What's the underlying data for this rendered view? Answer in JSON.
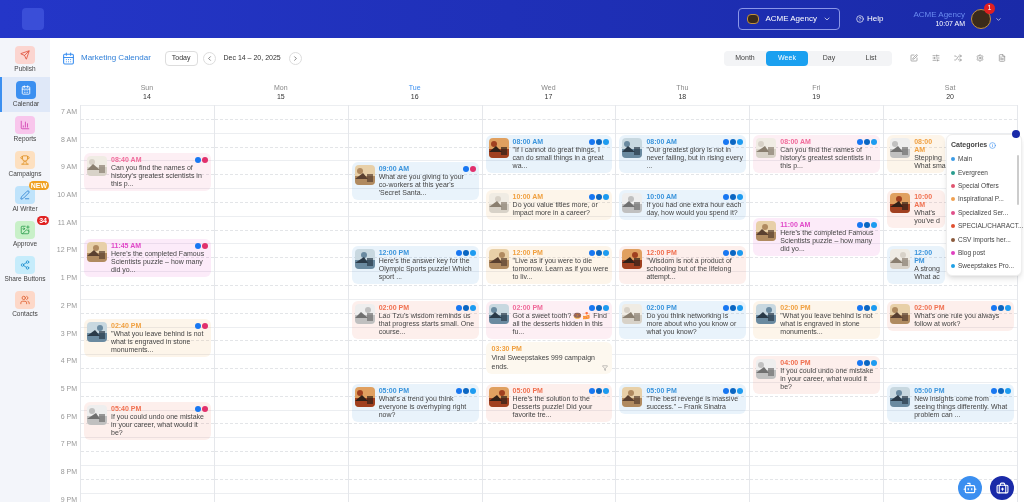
{
  "topbar": {
    "agency_button": "ACME Agency",
    "help": "Help",
    "account_name": "ACME Agency",
    "time": "10:07 AM",
    "notification_count": "1"
  },
  "sidebar": [
    {
      "kind": "publish",
      "label": "Publish",
      "selected": false
    },
    {
      "kind": "calendar",
      "label": "Calendar",
      "selected": true
    },
    {
      "kind": "reports",
      "label": "Reports",
      "selected": false
    },
    {
      "kind": "campaigns",
      "label": "Campaigns",
      "selected": false
    },
    {
      "kind": "writer",
      "label": "AI Writer",
      "selected": false,
      "badge": "NEW",
      "color": "#f0a020"
    },
    {
      "kind": "approve",
      "label": "Approve",
      "selected": false,
      "badge": "34",
      "color": "#e02020"
    },
    {
      "kind": "share",
      "label": "Share Buttons",
      "selected": false
    },
    {
      "kind": "contacts",
      "label": "Contacts",
      "selected": false
    }
  ],
  "toolbar": {
    "title": "Marketing Calendar",
    "today": "Today",
    "range": "Dec 14 – 20, 2025",
    "views": [
      {
        "label": "Month",
        "selected": false
      },
      {
        "label": "Week",
        "selected": true
      },
      {
        "label": "Day",
        "selected": false
      },
      {
        "label": "List",
        "selected": false
      }
    ]
  },
  "hours": [
    "7 AM",
    "8 AM",
    "9 AM",
    "10 AM",
    "11 AM",
    "12 PM",
    "1 PM",
    "2 PM",
    "3 PM",
    "4 PM",
    "5 PM",
    "6 PM",
    "7 PM",
    "8 PM",
    "9 PM"
  ],
  "days": [
    {
      "name": "Sun",
      "date": "14",
      "today": false,
      "events": [
        {
          "kind": "post",
          "time": "08:40 AM",
          "color": "#f06a9a",
          "text": "Can you find the names of history's greatest scientists in this p...",
          "networks": [
            {
              "kind": "facebook"
            },
            {
              "kind": "instagram"
            }
          ]
        },
        {
          "kind": "post",
          "time": "11:45 AM",
          "color": "#e048c8",
          "text": "Here's the completed Famous Scientists puzzle – how many did yo...",
          "networks": [
            {
              "kind": "facebook"
            },
            {
              "kind": "instagram"
            }
          ]
        },
        {
          "kind": "post",
          "time": "02:40 PM",
          "color": "#f0a040",
          "text": "\"What you leave behind is not what is engraved in stone monuments...",
          "networks": [
            {
              "kind": "facebook"
            },
            {
              "kind": "instagram"
            }
          ]
        },
        {
          "kind": "post",
          "time": "05:40 PM",
          "color": "#f07050",
          "text": "If you could undo one mistake in your career, what would it be?",
          "networks": [
            {
              "kind": "facebook"
            },
            {
              "kind": "instagram"
            }
          ]
        }
      ]
    },
    {
      "name": "Mon",
      "date": "15",
      "today": false
    },
    {
      "name": "Tue",
      "date": "16",
      "today": true,
      "events": [
        {
          "kind": "post",
          "time": "09:00 AM",
          "color": "#3a94dc",
          "text": "What are you giving to your co-workers at this year's 'Secret Santa...",
          "networks": [
            {
              "kind": "facebook"
            },
            {
              "kind": "instagram"
            }
          ]
        },
        {
          "kind": "post",
          "time": "12:00 PM",
          "color": "#3a94dc",
          "text": "Here's the answer key for the Olympic Sports puzzle! Which sport ...",
          "networks": [
            {
              "kind": "facebook"
            },
            {
              "kind": "linkedin"
            },
            {
              "kind": "twitter"
            }
          ]
        },
        {
          "kind": "post",
          "time": "02:00 PM",
          "color": "#f07050",
          "text": "Lao Tzu's wisdom reminds us that progress starts small. One course...",
          "networks": [
            {
              "kind": "facebook"
            },
            {
              "kind": "linkedin"
            },
            {
              "kind": "twitter"
            }
          ]
        },
        {
          "kind": "post",
          "time": "05:00 PM",
          "color": "#3a94dc",
          "text": "What's a trend you think everyone is overhyping right now?",
          "networks": [
            {
              "kind": "facebook"
            },
            {
              "kind": "linkedin"
            },
            {
              "kind": "twitter"
            }
          ]
        }
      ]
    },
    {
      "name": "Wed",
      "date": "17",
      "today": false,
      "events": [
        {
          "kind": "post",
          "time": "08:00 AM",
          "color": "#3a94dc",
          "text": "\"If I cannot do great things, I can do small things in a great wa...",
          "networks": [
            {
              "kind": "facebook"
            },
            {
              "kind": "linkedin"
            },
            {
              "kind": "twitter"
            }
          ]
        },
        {
          "kind": "post",
          "time": "10:00 AM",
          "color": "#f0a040",
          "text": "Do you value titles more, or impact more in a career?",
          "networks": [
            {
              "kind": "facebook"
            },
            {
              "kind": "linkedin"
            },
            {
              "kind": "twitter"
            }
          ]
        },
        {
          "kind": "post",
          "time": "12:00 PM",
          "color": "#f0a040",
          "text": "\"Live as if you were to die tomorrow. Learn as if you were to liv...",
          "networks": [
            {
              "kind": "facebook"
            },
            {
              "kind": "linkedin"
            },
            {
              "kind": "twitter"
            }
          ]
        },
        {
          "kind": "post",
          "time": "02:00 PM",
          "color": "#f06a9a",
          "text": "Got a sweet tooth? 🍩🍰 Find all the desserts hidden in this fu...",
          "networks": [
            {
              "kind": "facebook"
            },
            {
              "kind": "linkedin"
            },
            {
              "kind": "twitter"
            }
          ]
        },
        {
          "kind": "note",
          "time": "03:30 PM",
          "color": "#f0a040",
          "text": "Viral Sweepstakes 999 campaign ends."
        },
        {
          "kind": "post",
          "time": "05:00 PM",
          "color": "#f07050",
          "text": "Here's the solution to the Desserts puzzle! Did your favorite tre...",
          "networks": [
            {
              "kind": "facebook"
            },
            {
              "kind": "linkedin"
            },
            {
              "kind": "twitter"
            }
          ]
        }
      ]
    },
    {
      "name": "Thu",
      "date": "18",
      "today": false,
      "events": [
        {
          "kind": "post",
          "time": "08:00 AM",
          "color": "#3a94dc",
          "text": "\"Our greatest glory is not in never failing, but in rising every ...",
          "networks": [
            {
              "kind": "facebook"
            },
            {
              "kind": "linkedin"
            },
            {
              "kind": "twitter"
            }
          ]
        },
        {
          "kind": "post",
          "time": "10:00 AM",
          "color": "#3a94dc",
          "text": "If you had one extra hour each day, how would you spend it?",
          "networks": [
            {
              "kind": "facebook"
            },
            {
              "kind": "linkedin"
            },
            {
              "kind": "twitter"
            }
          ]
        },
        {
          "kind": "post",
          "time": "12:00 PM",
          "color": "#f07050",
          "text": "\"Wisdom is not a product of schooling but of the lifelong attempt...",
          "networks": [
            {
              "kind": "facebook"
            },
            {
              "kind": "linkedin"
            },
            {
              "kind": "twitter"
            }
          ]
        },
        {
          "kind": "post",
          "time": "02:00 PM",
          "color": "#3a94dc",
          "text": "Do you think networking is more about who you know or what you know?",
          "networks": [
            {
              "kind": "facebook"
            },
            {
              "kind": "linkedin"
            },
            {
              "kind": "twitter"
            }
          ]
        },
        {
          "kind": "post",
          "time": "05:00 PM",
          "color": "#3a94dc",
          "text": "\"The best revenge is massive success.\" – Frank Sinatra",
          "networks": [
            {
              "kind": "facebook"
            },
            {
              "kind": "linkedin"
            },
            {
              "kind": "twitter"
            }
          ]
        }
      ]
    },
    {
      "name": "Fri",
      "date": "19",
      "today": false,
      "events": [
        {
          "kind": "post",
          "time": "08:00 AM",
          "color": "#f06a9a",
          "text": "Can you find the names of history's greatest scientists in this p...",
          "networks": [
            {
              "kind": "facebook"
            },
            {
              "kind": "linkedin"
            },
            {
              "kind": "twitter"
            }
          ]
        },
        {
          "kind": "post",
          "time": "11:00 AM",
          "color": "#e048c8",
          "text": "Here's the completed Famous Scientists puzzle – how many did yo...",
          "networks": [
            {
              "kind": "facebook"
            },
            {
              "kind": "linkedin"
            },
            {
              "kind": "twitter"
            }
          ]
        },
        {
          "kind": "post",
          "time": "02:00 PM",
          "color": "#f0a040",
          "text": "\"What you leave behind is not what is engraved in stone monuments...",
          "networks": [
            {
              "kind": "facebook"
            },
            {
              "kind": "linkedin"
            },
            {
              "kind": "twitter"
            }
          ]
        },
        {
          "kind": "post",
          "time": "04:00 PM",
          "color": "#f07050",
          "text": "If you could undo one mistake in your career, what would it be?",
          "networks": [
            {
              "kind": "facebook"
            },
            {
              "kind": "linkedin"
            },
            {
              "kind": "twitter"
            }
          ]
        }
      ]
    },
    {
      "name": "Sat",
      "date": "20",
      "today": false,
      "events": [
        {
          "kind": "covered",
          "time": "08:00 AM",
          "color": "#f0a040",
          "text": "Stepping\nWhat sma"
        },
        {
          "kind": "covered",
          "time": "10:00 AM",
          "color": "#f07050",
          "text": "What's\nyou've d"
        },
        {
          "kind": "covered",
          "time": "12:00 PM",
          "color": "#3a94dc",
          "text": "A strong\nWhat ac"
        },
        {
          "kind": "post",
          "time": "02:00 PM",
          "color": "#f07050",
          "text": "What's one rule you always follow at work?",
          "networks": [
            {
              "kind": "facebook"
            },
            {
              "kind": "linkedin"
            },
            {
              "kind": "twitter"
            }
          ]
        },
        {
          "kind": "post",
          "time": "05:00 PM",
          "color": "#3a94dc",
          "text": "New insights come from seeing things differently. What problem can ...",
          "networks": [
            {
              "kind": "facebook"
            },
            {
              "kind": "linkedin"
            },
            {
              "kind": "twitter"
            }
          ]
        }
      ]
    }
  ],
  "categories": {
    "title": "Categories",
    "items": [
      {
        "label": "Main",
        "color": "#3b9be6"
      },
      {
        "label": "Evergreen",
        "color": "#2a9d8f"
      },
      {
        "label": "Special Offers",
        "color": "#e05570"
      },
      {
        "label": "Inspirational P...",
        "color": "#f0a050"
      },
      {
        "label": "Specialized Ser...",
        "color": "#e0508a"
      },
      {
        "label": "SPECIAL/CHARACT...",
        "color": "#e05030"
      },
      {
        "label": "CSV imports her...",
        "color": "#8b5a3c"
      },
      {
        "label": "Blog post",
        "color": "#e040c0"
      },
      {
        "label": "Sweepstakes Pro...",
        "color": "#1ea0e6"
      }
    ]
  }
}
